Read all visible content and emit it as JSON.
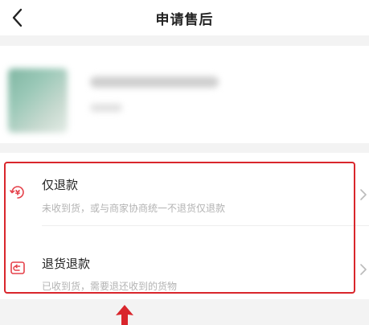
{
  "header": {
    "title": "申请售后",
    "back_icon": "chevron-left-icon"
  },
  "options": [
    {
      "title": "仅退款",
      "description": "未收到货，或与商家协商统一不退货仅退款",
      "icon": "yuan-refund-icon",
      "icon_color": "#e5414a"
    },
    {
      "title": "退货退款",
      "description": "已收到货，需要退还收到的货物",
      "icon": "return-box-icon",
      "icon_color": "#e5414a"
    }
  ],
  "colors": {
    "highlight": "#d9262c",
    "arrow": "#d9262c"
  }
}
